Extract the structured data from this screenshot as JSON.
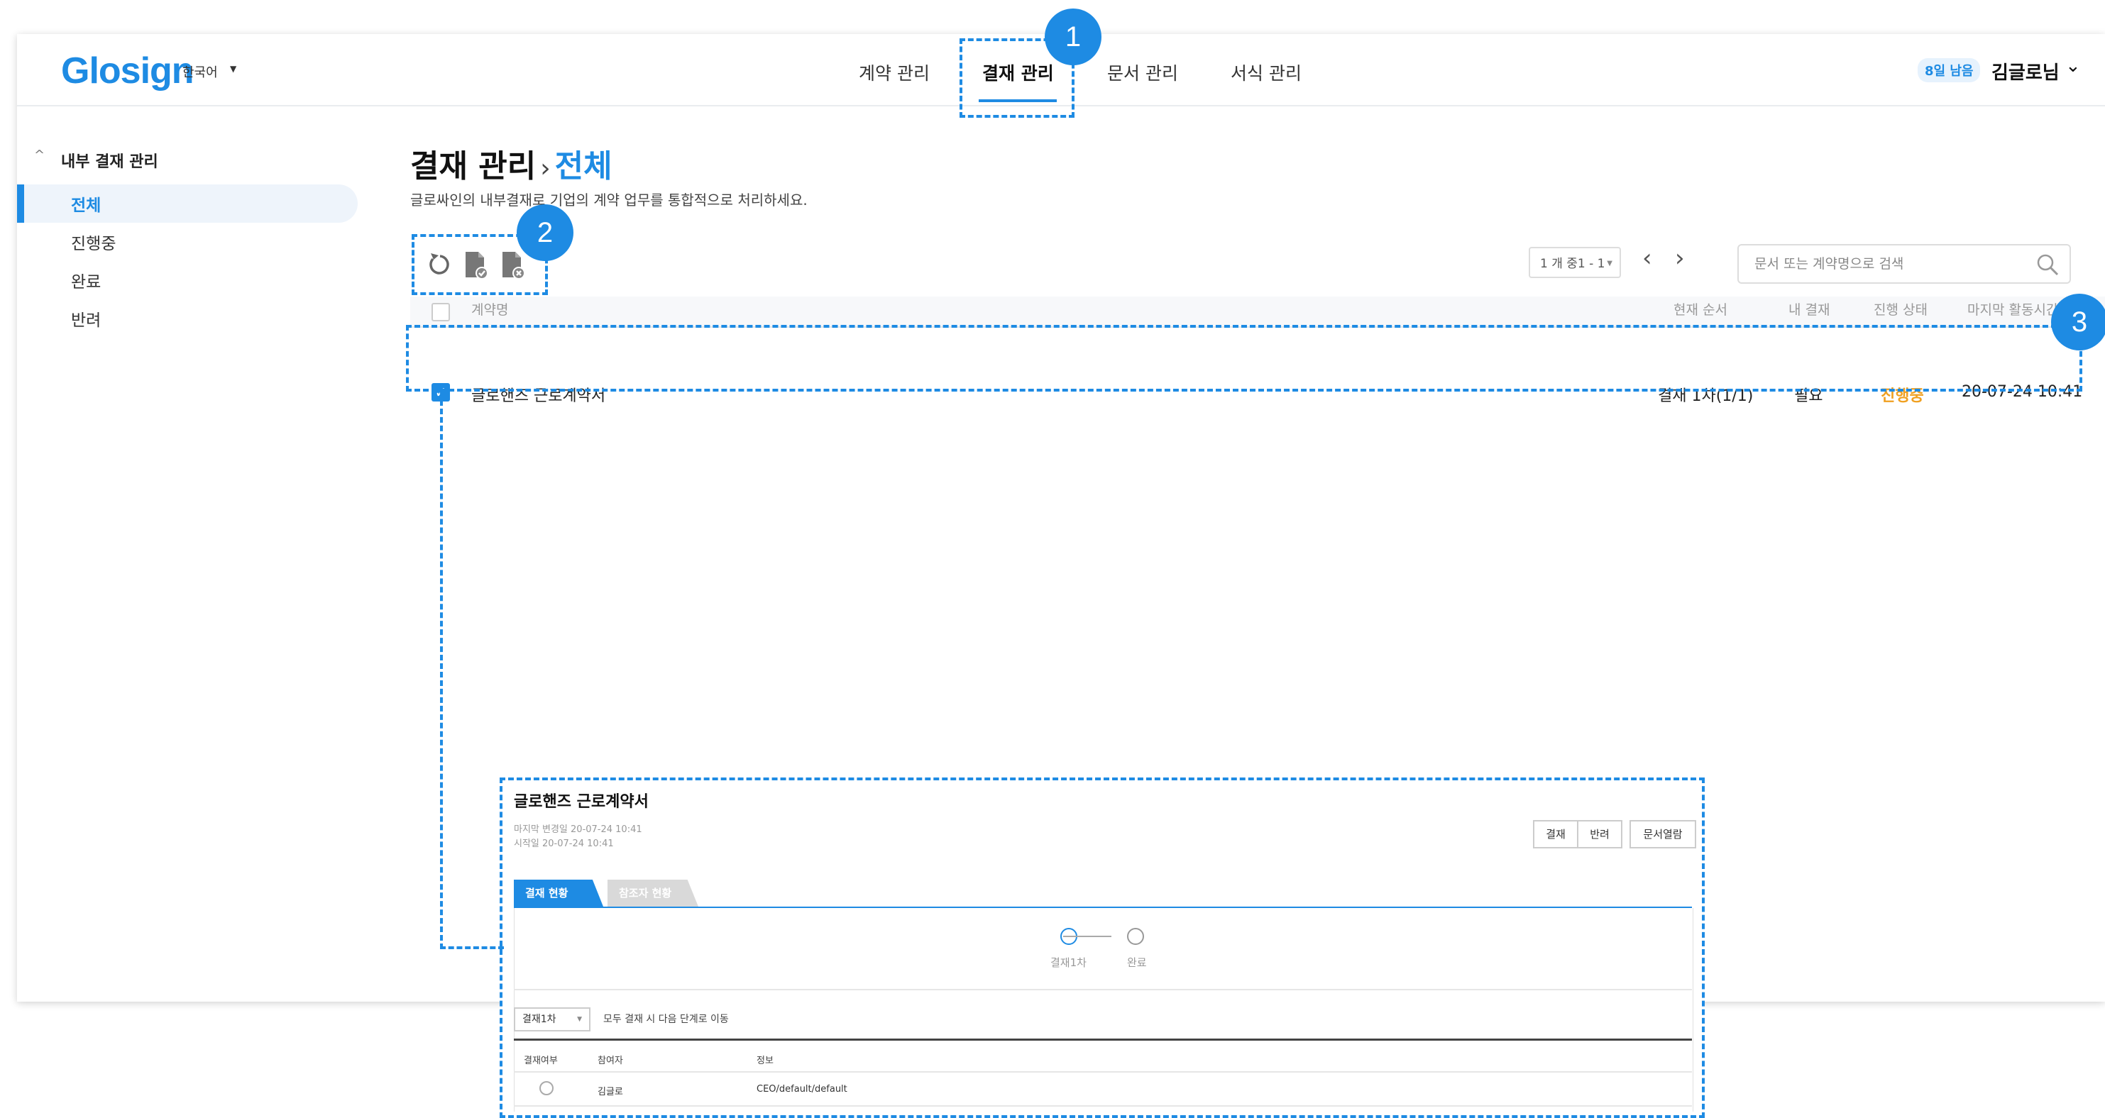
{
  "header": {
    "logo": "Glosign",
    "language": "한국어",
    "nav": [
      "계약 관리",
      "결재 관리",
      "문서 관리",
      "서식 관리"
    ],
    "active_nav": "결재 관리",
    "trial_badge": "8일 남음",
    "user_name": "김글로님"
  },
  "sidebar": {
    "section_title": "내부 결재 관리",
    "items": [
      "전체",
      "진행중",
      "완료",
      "반려"
    ],
    "active_item": "전체"
  },
  "page": {
    "title_parent": "결재 관리",
    "title_current": "전체",
    "subtitle": "글로싸인의 내부결재로 기업의 계약 업무를 통합적으로 처리하세요."
  },
  "toolbar": {
    "icons": [
      "refresh-icon",
      "approve-document-icon",
      "reject-document-icon"
    ],
    "pagination": "1 개 중1 - 1",
    "search_placeholder": "문서 또는 계약명으로 검색"
  },
  "table": {
    "columns": [
      "계약명",
      "현재 순서",
      "내 결재",
      "진행 상태",
      "마지막 활동시간"
    ],
    "rows": [
      {
        "checked": true,
        "name": "글로핸즈 근로계약서",
        "order": "결재 1차(1/1)",
        "my_approval": "필요",
        "status": "진행중",
        "last_activity": "20-07-24 10:41"
      }
    ]
  },
  "callouts": [
    "1",
    "2",
    "3"
  ],
  "detail": {
    "title": "글로핸즈 근로계약서",
    "modified": "마지막 변경일 20-07-24 10:41",
    "started": "시작일 20-07-24 10:41",
    "buttons": [
      "결재",
      "반려",
      "문서열람"
    ],
    "tabs": [
      "결재 현황",
      "참조자 현황"
    ],
    "steps": [
      "결재1차",
      "완료"
    ],
    "step_select": "결재1차",
    "step_note": "모두 결재 시 다음 단계로 이동",
    "table_columns": [
      "결재여부",
      "참여자",
      "정보"
    ],
    "table_row": {
      "participant": "김글로",
      "info": "CEO/default/default"
    }
  },
  "colors": {
    "accent": "#1e8be3",
    "status_in_progress": "#f0a020"
  }
}
